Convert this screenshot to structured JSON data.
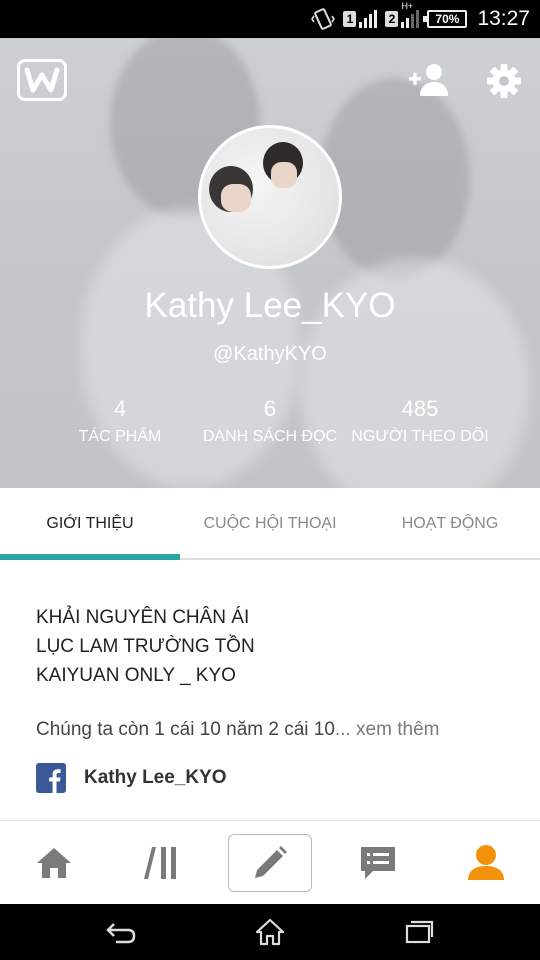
{
  "status_bar": {
    "sim1": "1",
    "sim2": "2",
    "network_type": "H+",
    "battery": "70%",
    "time": "13:27"
  },
  "header": {
    "user_name": "Kathy Lee_KYO",
    "handle": "@KathyKYO",
    "stats": [
      {
        "value": "4",
        "label": "TÁC PHẨM"
      },
      {
        "value": "6",
        "label": "DANH SÁCH ĐỌC"
      },
      {
        "value": "485",
        "label": "NGƯỜI THEO DÕI"
      }
    ]
  },
  "tabs": [
    {
      "label": "GIỚI THIỆU",
      "active": true
    },
    {
      "label": "CUỘC HỘI THOẠI",
      "active": false
    },
    {
      "label": "HOẠT ĐỘNG",
      "active": false
    }
  ],
  "about": {
    "lines": [
      "KHẢI NGUYÊN CHÂN ÁI",
      "LỤC LAM TRƯỜNG TỒN",
      "KAIYUAN ONLY _ KYO"
    ],
    "tagline": "Chúng ta còn 1 cái 10 năm 2 cái 10",
    "ellipsis": "...",
    "see_more": " xem thêm",
    "facebook_name": "Kathy Lee_KYO"
  },
  "bottom_nav": [
    {
      "icon": "home-icon"
    },
    {
      "icon": "library-icon"
    },
    {
      "icon": "pencil-icon"
    },
    {
      "icon": "messages-icon"
    },
    {
      "icon": "profile-icon"
    }
  ],
  "colors": {
    "accent": "#29a6a3",
    "nav_icon": "#7a7a7a",
    "profile_active": "#f2920c",
    "facebook": "#3b5998"
  }
}
